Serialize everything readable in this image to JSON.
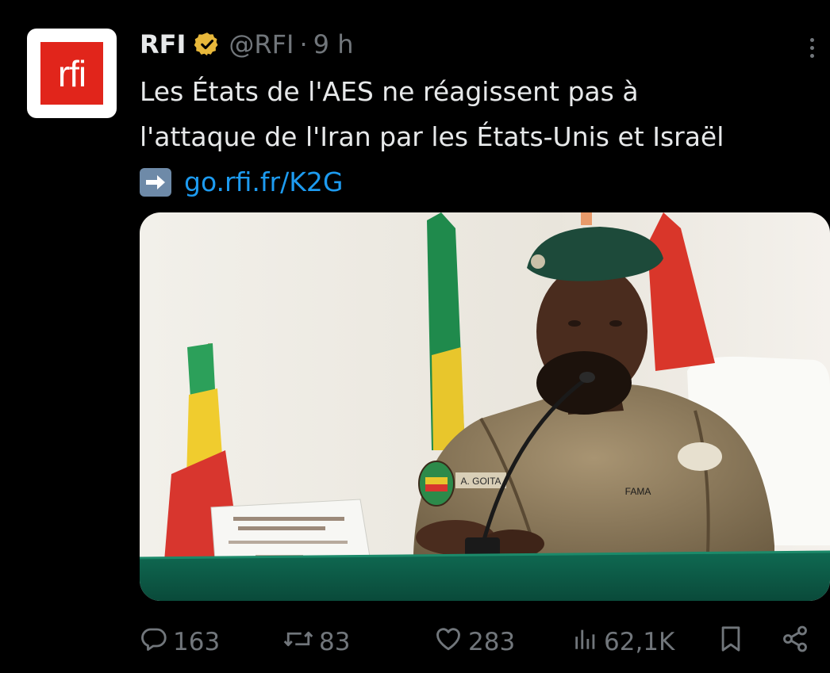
{
  "tweet": {
    "author_name": "RFI",
    "handle": "@RFI",
    "separator": "·",
    "time": "9 h",
    "avatar_text": "rfi",
    "text_line1": "Les États de l'AES ne réagissent pas à",
    "text_line2": "l'attaque de l'Iran par les États-Unis et Israël",
    "link_text": "go.rfi.fr/K2G",
    "media_badge_text": "FAMA",
    "media_name_tag": "A. GOITA"
  },
  "actions": {
    "replies": "163",
    "reposts": "83",
    "likes": "283",
    "views": "62,1K"
  },
  "colors": {
    "background": "#000000",
    "text": "#e7e9ea",
    "muted": "#71767b",
    "link": "#1d9bf0",
    "verified_gold": "#e8b83b",
    "rfi_red": "#e1251b"
  },
  "icons": {
    "verified": "verified-badge-icon",
    "more": "more-options-icon",
    "arrow": "right-arrow-emoji-icon",
    "reply": "reply-icon",
    "repost": "repost-icon",
    "like": "heart-icon",
    "views": "views-chart-icon",
    "bookmark": "bookmark-icon",
    "share": "share-icon"
  }
}
